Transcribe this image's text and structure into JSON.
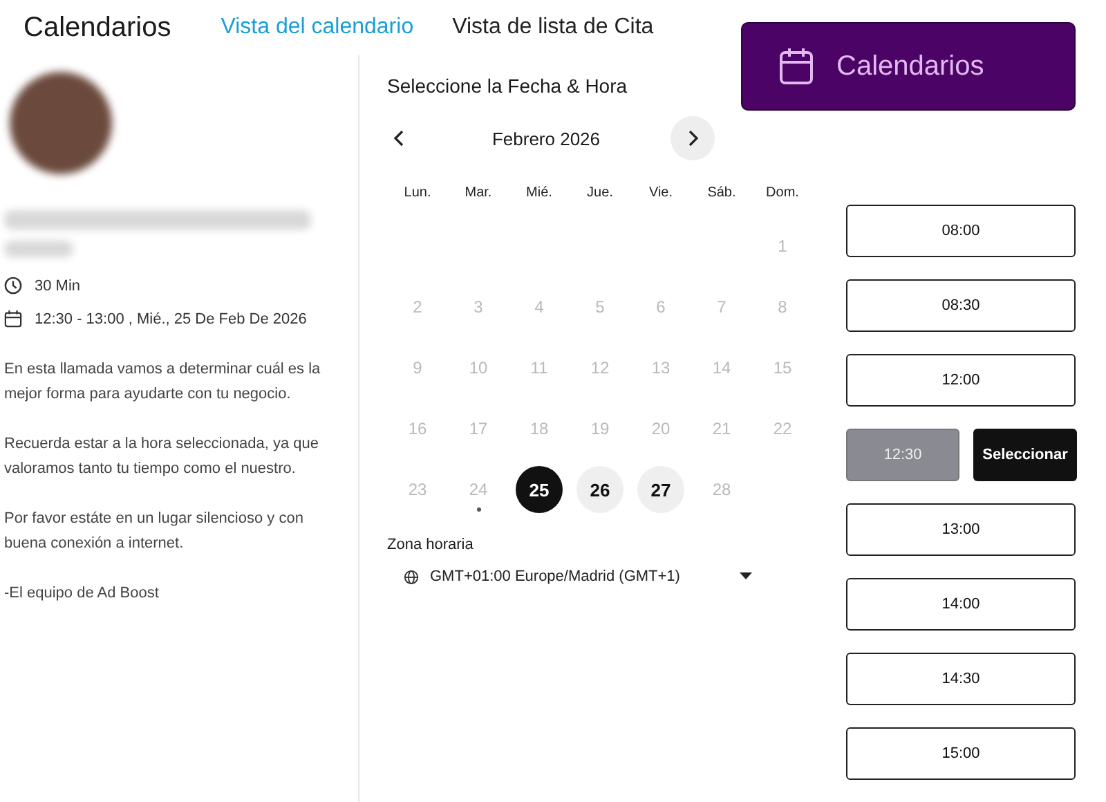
{
  "header": {
    "title": "Calendarios",
    "tabs": [
      {
        "label": "Vista del calendario",
        "selected": true
      },
      {
        "label": "Vista de lista de Cita",
        "selected": false
      }
    ],
    "action_button": "Calendarios"
  },
  "event": {
    "duration": "30 Min",
    "when": "12:30 - 13:00 , Mié., 25 De Feb De 2026",
    "paragraphs": [
      "En esta llamada vamos a determinar cuál es la mejor forma para ayudarte con tu negocio.",
      "Recuerda estar a la hora seleccionada, ya que valoramos tanto tu tiempo como el nuestro.",
      "Por favor estáte en un lugar silencioso y con buena conexión a internet.",
      "-El equipo de Ad Boost"
    ]
  },
  "picker": {
    "title": "Seleccione la Fecha & Hora",
    "month": "Febrero 2026",
    "weekdays": [
      "Lun.",
      "Mar.",
      "Mié.",
      "Jue.",
      "Vie.",
      "Sáb.",
      "Dom."
    ],
    "weeks": [
      [
        {
          "kind": "blank"
        },
        {
          "kind": "blank"
        },
        {
          "kind": "blank"
        },
        {
          "kind": "blank"
        },
        {
          "kind": "blank"
        },
        {
          "kind": "blank"
        },
        {
          "kind": "day",
          "day": "1",
          "available": false,
          "selected": false,
          "today": false
        }
      ],
      [
        {
          "kind": "day",
          "day": "2",
          "available": false,
          "selected": false,
          "today": false
        },
        {
          "kind": "day",
          "day": "3",
          "available": false,
          "selected": false,
          "today": false
        },
        {
          "kind": "day",
          "day": "4",
          "available": false,
          "selected": false,
          "today": false
        },
        {
          "kind": "day",
          "day": "5",
          "available": false,
          "selected": false,
          "today": false
        },
        {
          "kind": "day",
          "day": "6",
          "available": false,
          "selected": false,
          "today": false
        },
        {
          "kind": "day",
          "day": "7",
          "available": false,
          "selected": false,
          "today": false
        },
        {
          "kind": "day",
          "day": "8",
          "available": false,
          "selected": false,
          "today": false
        }
      ],
      [
        {
          "kind": "day",
          "day": "9",
          "available": false,
          "selected": false,
          "today": false
        },
        {
          "kind": "day",
          "day": "10",
          "available": false,
          "selected": false,
          "today": false
        },
        {
          "kind": "day",
          "day": "11",
          "available": false,
          "selected": false,
          "today": false
        },
        {
          "kind": "day",
          "day": "12",
          "available": false,
          "selected": false,
          "today": false
        },
        {
          "kind": "day",
          "day": "13",
          "available": false,
          "selected": false,
          "today": false
        },
        {
          "kind": "day",
          "day": "14",
          "available": false,
          "selected": false,
          "today": false
        },
        {
          "kind": "day",
          "day": "15",
          "available": false,
          "selected": false,
          "today": false
        }
      ],
      [
        {
          "kind": "day",
          "day": "16",
          "available": false,
          "selected": false,
          "today": false
        },
        {
          "kind": "day",
          "day": "17",
          "available": false,
          "selected": false,
          "today": false
        },
        {
          "kind": "day",
          "day": "18",
          "available": false,
          "selected": false,
          "today": false
        },
        {
          "kind": "day",
          "day": "19",
          "available": false,
          "selected": false,
          "today": false
        },
        {
          "kind": "day",
          "day": "20",
          "available": false,
          "selected": false,
          "today": false
        },
        {
          "kind": "day",
          "day": "21",
          "available": false,
          "selected": false,
          "today": false
        },
        {
          "kind": "day",
          "day": "22",
          "available": false,
          "selected": false,
          "today": false
        }
      ],
      [
        {
          "kind": "day",
          "day": "23",
          "available": false,
          "selected": false,
          "today": false
        },
        {
          "kind": "day",
          "day": "24",
          "available": false,
          "selected": false,
          "today": true
        },
        {
          "kind": "day",
          "day": "25",
          "available": true,
          "selected": true,
          "today": false
        },
        {
          "kind": "day",
          "day": "26",
          "available": true,
          "selected": false,
          "today": false
        },
        {
          "kind": "day",
          "day": "27",
          "available": true,
          "selected": false,
          "today": false
        },
        {
          "kind": "day",
          "day": "28",
          "available": false,
          "selected": false,
          "today": false
        },
        {
          "kind": "blank"
        }
      ]
    ],
    "timezone_label": "Zona horaria",
    "timezone": "GMT+01:00 Europe/Madrid (GMT+1)"
  },
  "slots": [
    {
      "time": "08:00",
      "selected": false
    },
    {
      "time": "08:30",
      "selected": false
    },
    {
      "time": "12:00",
      "selected": false
    },
    {
      "time": "12:30",
      "selected": true
    },
    {
      "time": "13:00",
      "selected": false
    },
    {
      "time": "14:00",
      "selected": false
    },
    {
      "time": "14:30",
      "selected": false
    },
    {
      "time": "15:00",
      "selected": false
    }
  ],
  "confirm_button": "Seleccionar"
}
